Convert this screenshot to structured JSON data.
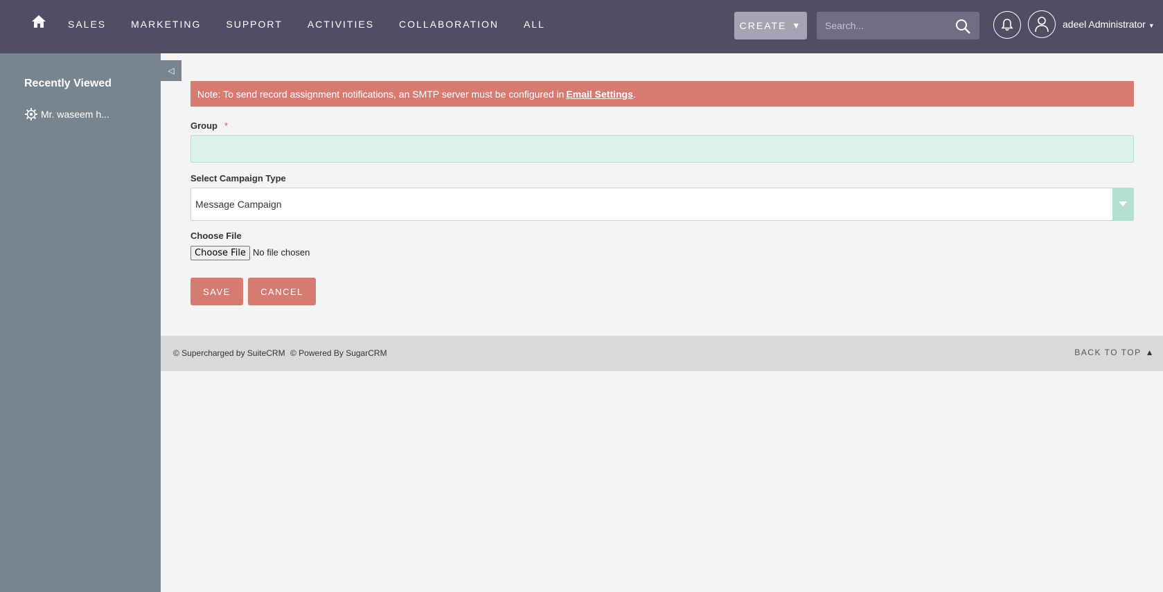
{
  "nav": {
    "items": [
      {
        "label": "SALES"
      },
      {
        "label": "MARKETING"
      },
      {
        "label": "SUPPORT"
      },
      {
        "label": "ACTIVITIES"
      },
      {
        "label": "COLLABORATION"
      },
      {
        "label": "ALL"
      }
    ],
    "create_label": "CREATE",
    "search_placeholder": "Search...",
    "user_name": "adeel Administrator"
  },
  "sidebar": {
    "title": "Recently Viewed",
    "items": [
      {
        "label": "Mr. waseem h..."
      }
    ]
  },
  "alert": {
    "text": "Note: To send record assignment notifications, an SMTP server must be configured in",
    "link_text": "Email Settings",
    "suffix": "."
  },
  "form": {
    "group_label": "Group",
    "required_marker": "*",
    "group_value": "",
    "campaign_type_label": "Select Campaign Type",
    "campaign_type_value": "Message Campaign",
    "file_label": "Choose File",
    "file_button": "Choose File",
    "file_status": "No file chosen",
    "save_label": "SAVE",
    "cancel_label": "CANCEL"
  },
  "footer": {
    "credit_suite": "© Supercharged by SuiteCRM",
    "credit_sugar": "© Powered By SugarCRM",
    "back_to_top": "BACK TO TOP"
  },
  "colors": {
    "topbar": "#534d64",
    "sidebar": "#778591",
    "accent": "#d77a70",
    "field_bg": "#dcf3ec"
  }
}
